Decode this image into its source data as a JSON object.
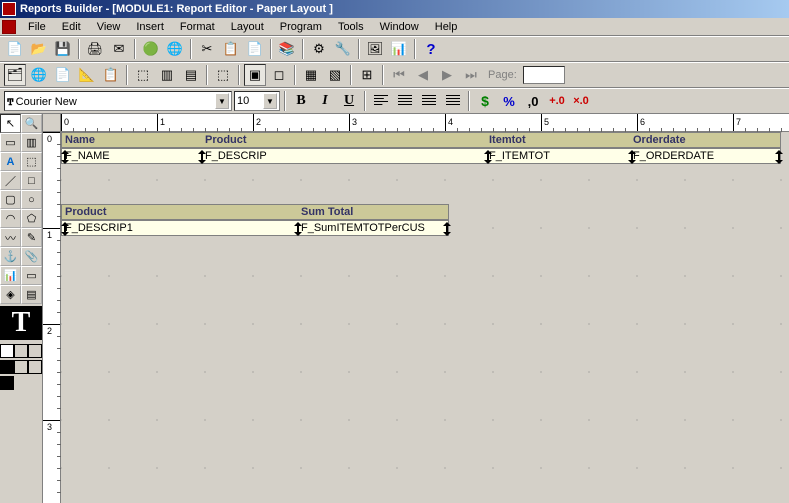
{
  "title": "Reports Builder - [MODULE1: Report Editor - Paper Layout ]",
  "menubar": [
    "File",
    "Edit",
    "View",
    "Insert",
    "Format",
    "Layout",
    "Program",
    "Tools",
    "Window",
    "Help"
  ],
  "toolbar2": {
    "page_label": "Page:"
  },
  "toolbar3": {
    "font": "Courier New",
    "size": "10",
    "currency": "$",
    "percent": "%",
    "comma": ",0"
  },
  "ruler_h": {
    "zero": "0",
    "ticks": [
      "1",
      "2",
      "3",
      "4",
      "5",
      "6",
      "7"
    ]
  },
  "ruler_v": {
    "zero": "0",
    "ticks": [
      "1",
      "2",
      "3"
    ]
  },
  "layout": {
    "group1": {
      "headers": [
        "Name",
        "Product",
        "Itemtot",
        "Orderdate"
      ],
      "fields": [
        "F_NAME",
        "F_DESCRIP",
        "F_ITEMTOT",
        "F_ORDERDATE"
      ]
    },
    "group2": {
      "headers": [
        "Product",
        "Sum Total"
      ],
      "fields": [
        "F_DESCRIP1",
        "F_SumITEMTOTPerCUS"
      ]
    }
  },
  "palette": {
    "big_t": "T"
  }
}
